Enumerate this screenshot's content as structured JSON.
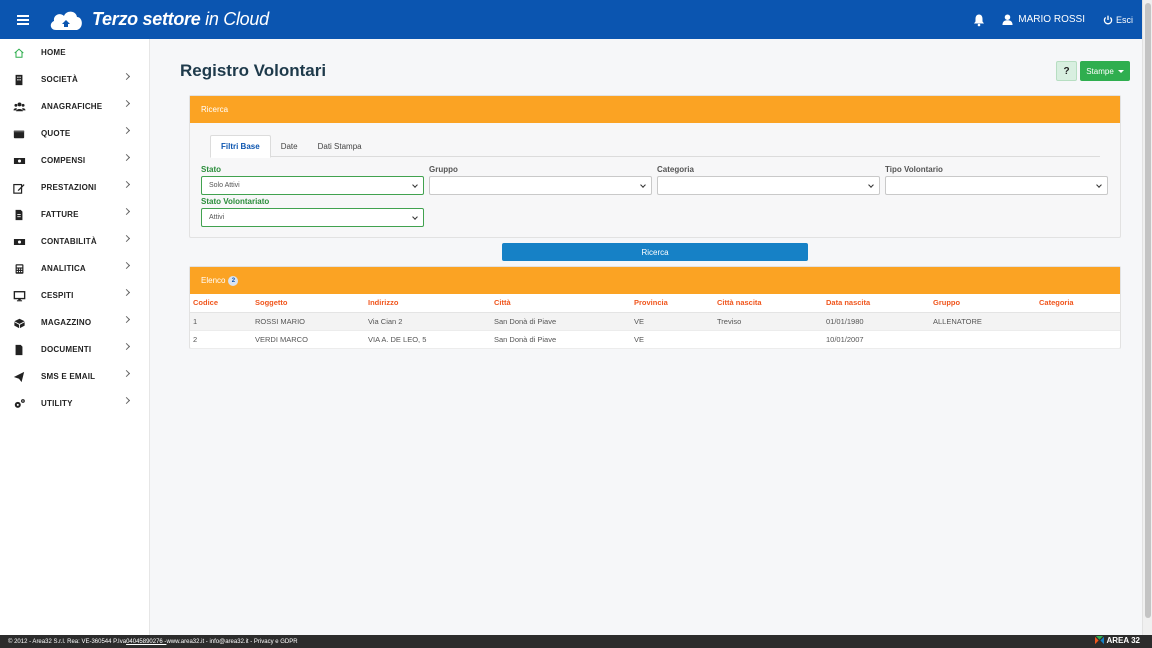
{
  "header": {
    "app_title_bold": "Terzo settore",
    "app_title_rest": "in Cloud",
    "user_name": "MARIO ROSSI",
    "logout_label": "Esci",
    "brand_color": "#0b55b0"
  },
  "sidebar": {
    "items": [
      {
        "label": "HOME",
        "icon": "home-icon",
        "has_children": false
      },
      {
        "label": "SOCIETÀ",
        "icon": "building-icon",
        "has_children": true
      },
      {
        "label": "ANAGRAFICHE",
        "icon": "users-icon",
        "has_children": true
      },
      {
        "label": "QUOTE",
        "icon": "wallet-icon",
        "has_children": true
      },
      {
        "label": "COMPENSI",
        "icon": "money-icon",
        "has_children": true
      },
      {
        "label": "PRESTAZIONI",
        "icon": "edit-icon",
        "has_children": true
      },
      {
        "label": "FATTURE",
        "icon": "invoice-icon",
        "has_children": true
      },
      {
        "label": "CONTABILITÀ",
        "icon": "cash-icon",
        "has_children": true
      },
      {
        "label": "ANALITICA",
        "icon": "calculator-icon",
        "has_children": true
      },
      {
        "label": "CESPITI",
        "icon": "monitor-icon",
        "has_children": true
      },
      {
        "label": "MAGAZZINO",
        "icon": "boxes-icon",
        "has_children": true
      },
      {
        "label": "DOCUMENTI",
        "icon": "file-icon",
        "has_children": true
      },
      {
        "label": "SMS E EMAIL",
        "icon": "send-icon",
        "has_children": true
      },
      {
        "label": "UTILITY",
        "icon": "cogs-icon",
        "has_children": true
      }
    ]
  },
  "main": {
    "page_title": "Registro Volontari",
    "help_label": "?",
    "print_label": "Stampe",
    "search_panel": {
      "title": "Ricerca",
      "tabs": [
        "Filtri Base",
        "Date",
        "Dati Stampa"
      ],
      "active_tab": "Filtri Base",
      "fields": {
        "stato": {
          "label": "Stato",
          "value": "Solo Attivi"
        },
        "gruppo": {
          "label": "Gruppo",
          "value": ""
        },
        "categoria": {
          "label": "Categoria",
          "value": ""
        },
        "tipo_volontario": {
          "label": "Tipo Volontario",
          "value": ""
        },
        "stato_volontariato": {
          "label": "Stato Volontariato",
          "value": "Attivi"
        }
      },
      "search_button": "Ricerca"
    },
    "list_panel": {
      "title": "Elenco",
      "count": "2",
      "columns": [
        "Codice",
        "Soggetto",
        "Indirizzo",
        "Città",
        "Provincia",
        "Città nascita",
        "Data nascita",
        "Gruppo",
        "Categoria"
      ],
      "rows": [
        [
          "1",
          "ROSSI MARIO",
          "Via Cian 2",
          "San Donà di Piave",
          "VE",
          "Treviso",
          "01/01/1980",
          "ALLENATORE",
          ""
        ],
        [
          "2",
          "VERDI MARCO",
          "VIA A. DE LEO, 5",
          "San Donà di Piave",
          "VE",
          "",
          "10/01/2007",
          "",
          ""
        ]
      ]
    }
  },
  "footer": {
    "text_before": "© 2012 - Area32 S.r.l. Rea: VE-360544 P.Iva",
    "vat": " 04045890276 -",
    "text_after": " www.area32.it - info@area32.it - Privacy e GDPR",
    "logo_label": "AREA 32"
  },
  "colors": {
    "panel_header": "#fba323",
    "table_header_text": "#f0561d",
    "search_button": "#1681c6",
    "print_button": "#2fae4f"
  }
}
